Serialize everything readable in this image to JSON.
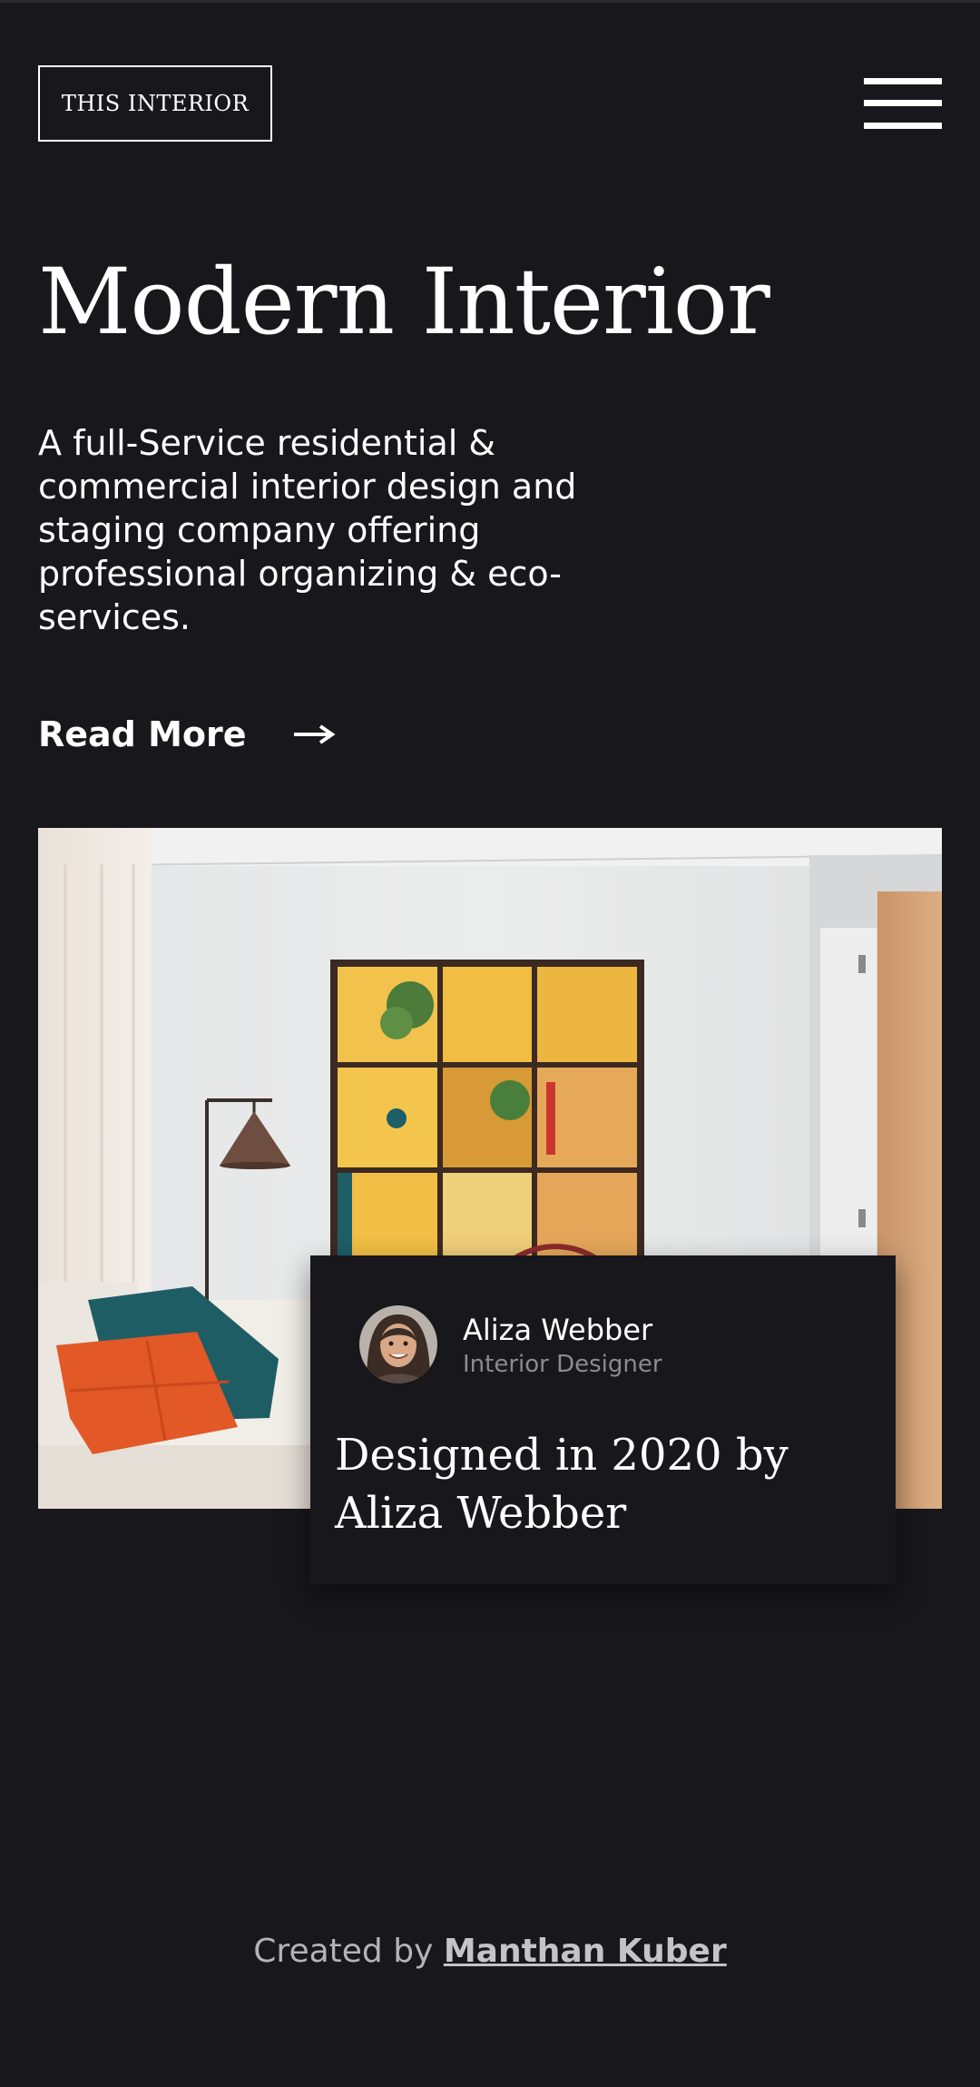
{
  "header": {
    "logo_text": "THIS INTERIOR",
    "menu_icon": "hamburger-menu-icon"
  },
  "hero": {
    "title": "Modern Interior",
    "description": "A full-Service residential & commercial interior design and staging company offering professional organizing & eco-services.",
    "read_more_label": "Read More",
    "read_more_icon": "arrow-right-icon"
  },
  "card": {
    "name": "Aliza Webber",
    "role": "Interior Designer",
    "title": "Designed in 2020 by Aliza Webber"
  },
  "footer": {
    "prefix": "Created by",
    "author": "Manthan Kuber"
  },
  "colors": {
    "background": "#18171c",
    "text": "#ffffff",
    "muted": "#8c8b90"
  }
}
